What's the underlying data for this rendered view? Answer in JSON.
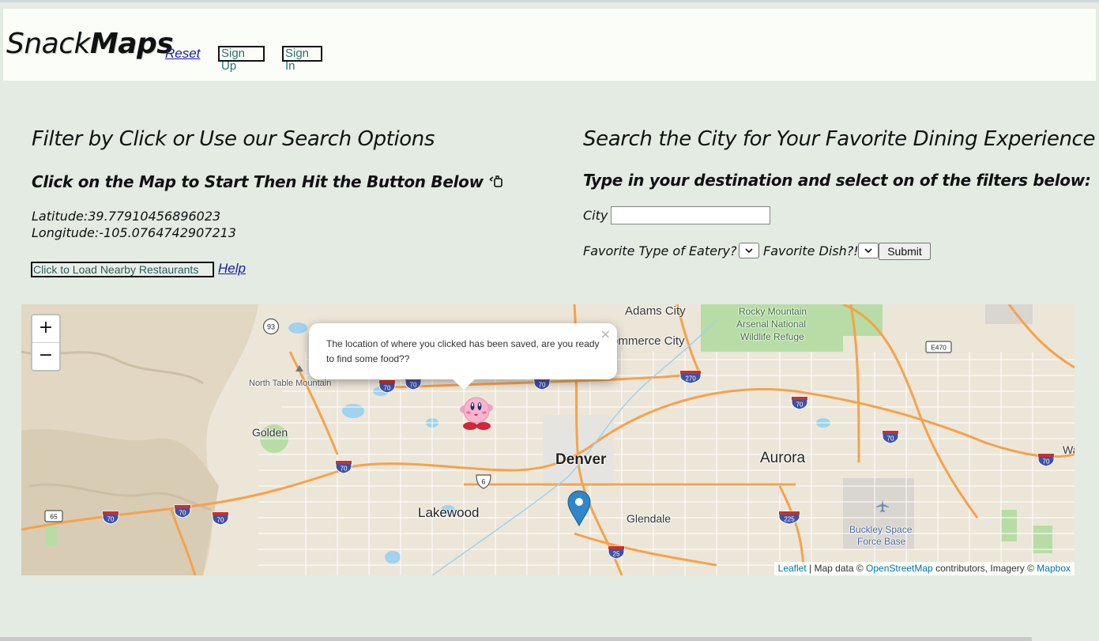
{
  "brand": {
    "light": "Snack",
    "bold": "Maps"
  },
  "nav": {
    "reset": "Reset",
    "sign_up": "Sign Up",
    "sign_in": "Sign In"
  },
  "left": {
    "title": "Filter by Click or Use our Search Options",
    "subtitle": "Click on the Map to Start Then Hit the Button Below",
    "subtitle_icon": "pointer-hand-icon",
    "latitude_label": "Latitude:",
    "latitude": "39.77910456896023",
    "longitude_label": "Longitude:",
    "longitude": "-105.0764742907213",
    "load_button": "Click to Load Nearby Restaurants",
    "help": "Help"
  },
  "right": {
    "title": "Search the City for Your Favorite Dining Experience",
    "subtitle": "Type in your destination and select on of the filters below:",
    "city_label": "City",
    "city_value": "",
    "eatery_label": "Favorite Type of Eatery?",
    "dish_label": "Favorite Dish?!",
    "submit": "Submit"
  },
  "map": {
    "zoom_in": "+",
    "zoom_out": "−",
    "popup_text": "The location of where you clicked has been saved, are you ready to find some food??",
    "popup_close": "×",
    "places": {
      "adams_city": "Adams City",
      "rocky_mountain": "Rocky Mountain",
      "arsenal": "Arsenal National",
      "wildlife": "Wildlife Refuge",
      "commerce_city": "ommerce City",
      "north_table": "North Table Mountain",
      "golden": "Golden",
      "denver": "Denver",
      "aurora": "Aurora",
      "lakewood": "Lakewood",
      "glendale": "Glendale",
      "buckley1": "Buckley Space",
      "buckley2": "Force Base",
      "wa": "Wa"
    },
    "shields": {
      "i70": "70",
      "i270": "270",
      "i225": "225",
      "i25": "25",
      "us6": "6",
      "co93": "93",
      "co65": "65",
      "e470": "E470"
    },
    "attribution": {
      "leaflet": "Leaflet",
      "sep": " | Map data © ",
      "osm": "OpenStreetMap",
      "contrib": " contributors, Imagery © ",
      "mapbox": "Mapbox"
    },
    "colors": {
      "road": "#f6a24a",
      "water": "#7fc6e8",
      "park": "#a9d79a",
      "marker": "#2f86c8"
    }
  }
}
